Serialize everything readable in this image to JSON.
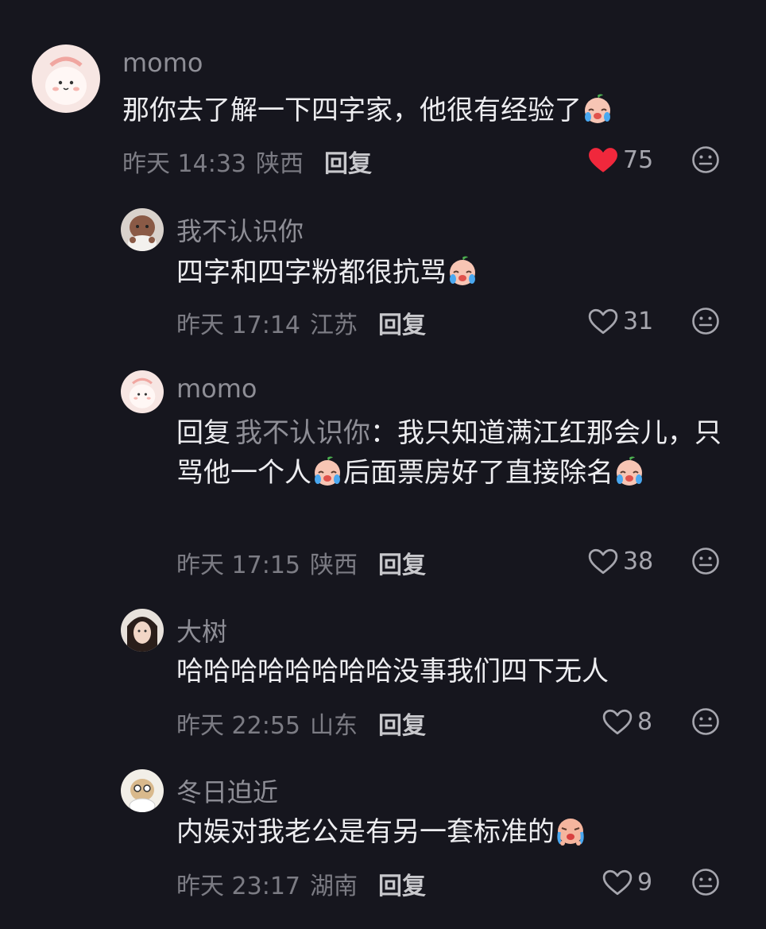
{
  "comments": [
    {
      "username": "momo",
      "text": "那你去了解一下四字家，他很有经验了",
      "emoji": "crying-face-emoji",
      "time": "昨天 14:33",
      "location": "陕西",
      "reply_label": "回复",
      "likes": "75",
      "liked": true
    },
    {
      "username": "我不认识你",
      "text": "四字和四字粉都很抗骂",
      "emoji": "crying-face-emoji",
      "time": "昨天 17:14",
      "location": "江苏",
      "reply_label": "回复",
      "likes": "31",
      "liked": false
    },
    {
      "username": "momo",
      "reply_prefix": "回复",
      "reply_target": "我不认识你",
      "text_part1": "：我只知道满江红那会儿，只骂他一个人",
      "text_part2": "后面票房好了直接除名",
      "emoji": "crying-face-emoji",
      "time": "昨天 17:15",
      "location": "陕西",
      "reply_label": "回复",
      "likes": "38",
      "liked": false
    },
    {
      "username": "大树",
      "text": "哈哈哈哈哈哈哈哈没事我们四下无人",
      "time": "昨天 22:55",
      "location": "山东",
      "reply_label": "回复",
      "likes": "8",
      "liked": false
    },
    {
      "username": "冬日迫近",
      "text": "内娱对我老公是有另一套标准的",
      "emoji": "sobbing-face-emoji",
      "time": "昨天 23:17",
      "location": "湖南",
      "reply_label": "回复",
      "likes": "9",
      "liked": false
    }
  ],
  "colors": {
    "background": "#16161e",
    "liked_heart": "#f0283c",
    "meta_text": "#7c7c84",
    "username_text": "#8e8e96"
  },
  "icons": {
    "like": "heart-icon",
    "reaction": "neutral-face-icon"
  }
}
